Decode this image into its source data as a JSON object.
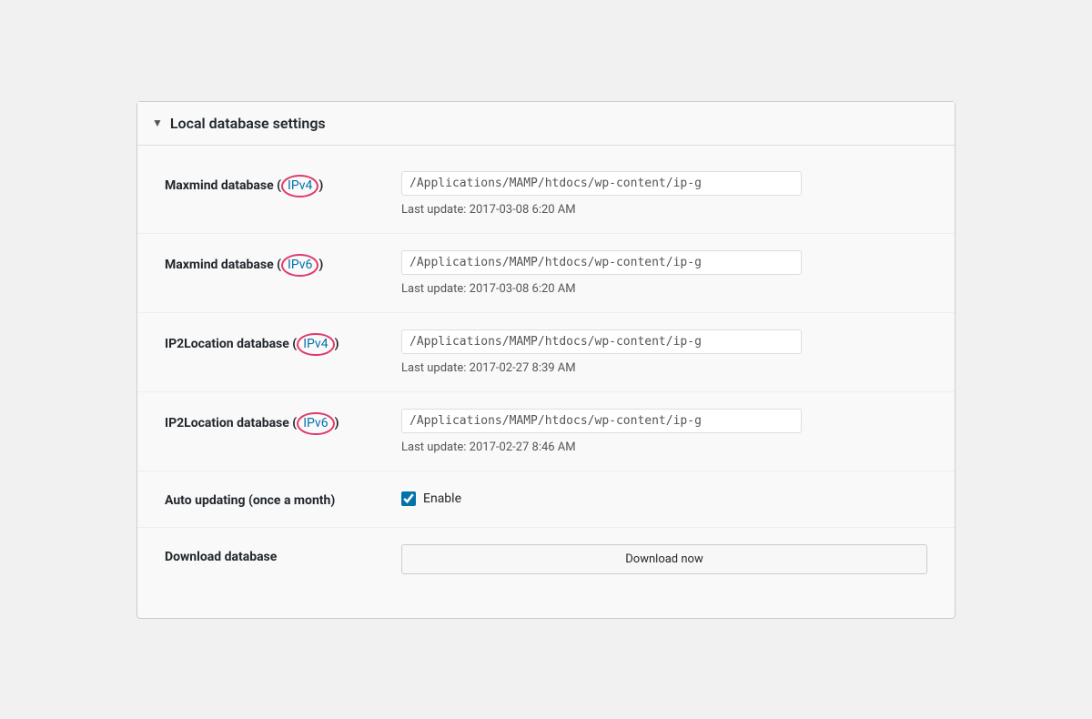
{
  "panel": {
    "title": "Local database settings",
    "toggle_icon": "▼"
  },
  "rows": [
    {
      "id": "maxmind-ipv4",
      "label": "Maxmind database",
      "link_text": "IPv4",
      "path_value": "/Applications/MAMP/htdocs/wp-content/ip-g",
      "last_update": "Last update: 2017-03-08 6:20 AM"
    },
    {
      "id": "maxmind-ipv6",
      "label": "Maxmind database",
      "link_text": "IPv6",
      "path_value": "/Applications/MAMP/htdocs/wp-content/ip-g",
      "last_update": "Last update: 2017-03-08 6:20 AM"
    },
    {
      "id": "ip2location-ipv4",
      "label": "IP2Location database",
      "link_text": "IPv4",
      "path_value": "/Applications/MAMP/htdocs/wp-content/ip-g",
      "last_update": "Last update: 2017-02-27 8:39 AM"
    },
    {
      "id": "ip2location-ipv6",
      "label": "IP2Location database",
      "link_text": "IPv6",
      "path_value": "/Applications/MAMP/htdocs/wp-content/ip-g",
      "last_update": "Last update: 2017-02-27 8:46 AM"
    }
  ],
  "auto_updating": {
    "label": "Auto updating (once a month)",
    "checkbox_label": "Enable",
    "checked": true
  },
  "download_database": {
    "label": "Download database",
    "button_label": "Download now"
  }
}
